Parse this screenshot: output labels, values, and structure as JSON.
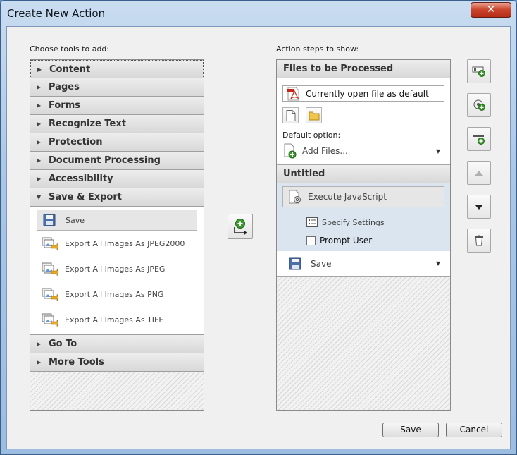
{
  "window": {
    "title": "Create New Action",
    "close_label": "✕"
  },
  "left": {
    "label": "Choose tools to add:",
    "categories_top": [
      {
        "label": "Content",
        "expanded": false
      },
      {
        "label": "Pages",
        "expanded": false
      },
      {
        "label": "Forms",
        "expanded": false
      },
      {
        "label": "Recognize Text",
        "expanded": false
      },
      {
        "label": "Protection",
        "expanded": false
      },
      {
        "label": "Document Processing",
        "expanded": false
      },
      {
        "label": "Accessibility",
        "expanded": false
      },
      {
        "label": "Save & Export",
        "expanded": true
      }
    ],
    "tools": [
      {
        "label": "Save",
        "icon": "floppy-disk-icon",
        "selected": true
      },
      {
        "label": "Export All Images As JPEG2000",
        "icon": "export-image-icon"
      },
      {
        "label": "Export All Images As JPEG",
        "icon": "export-image-icon"
      },
      {
        "label": "Export All Images As PNG",
        "icon": "export-image-icon"
      },
      {
        "label": "Export All Images As TIFF",
        "icon": "export-image-icon"
      }
    ],
    "categories_bottom": [
      {
        "label": "Go To",
        "expanded": false
      },
      {
        "label": "More Tools",
        "expanded": false
      }
    ]
  },
  "right": {
    "label": "Action steps to show:",
    "files_header": "Files to be Processed",
    "file_value": "Currently open file as default",
    "default_option_label": "Default option:",
    "default_option_value": "Add Files...",
    "untitled_header": "Untitled",
    "step_execute": "Execute JavaScript",
    "specify_settings": "Specify Settings",
    "prompt_user": "Prompt User",
    "prompt_user_checked": false,
    "save_step": "Save"
  },
  "buttons": {
    "save": "Save",
    "cancel": "Cancel"
  },
  "colors": {
    "accent_blue": "#5c8fc4",
    "close_red": "#c9432a",
    "add_green": "#3a9a2c"
  }
}
